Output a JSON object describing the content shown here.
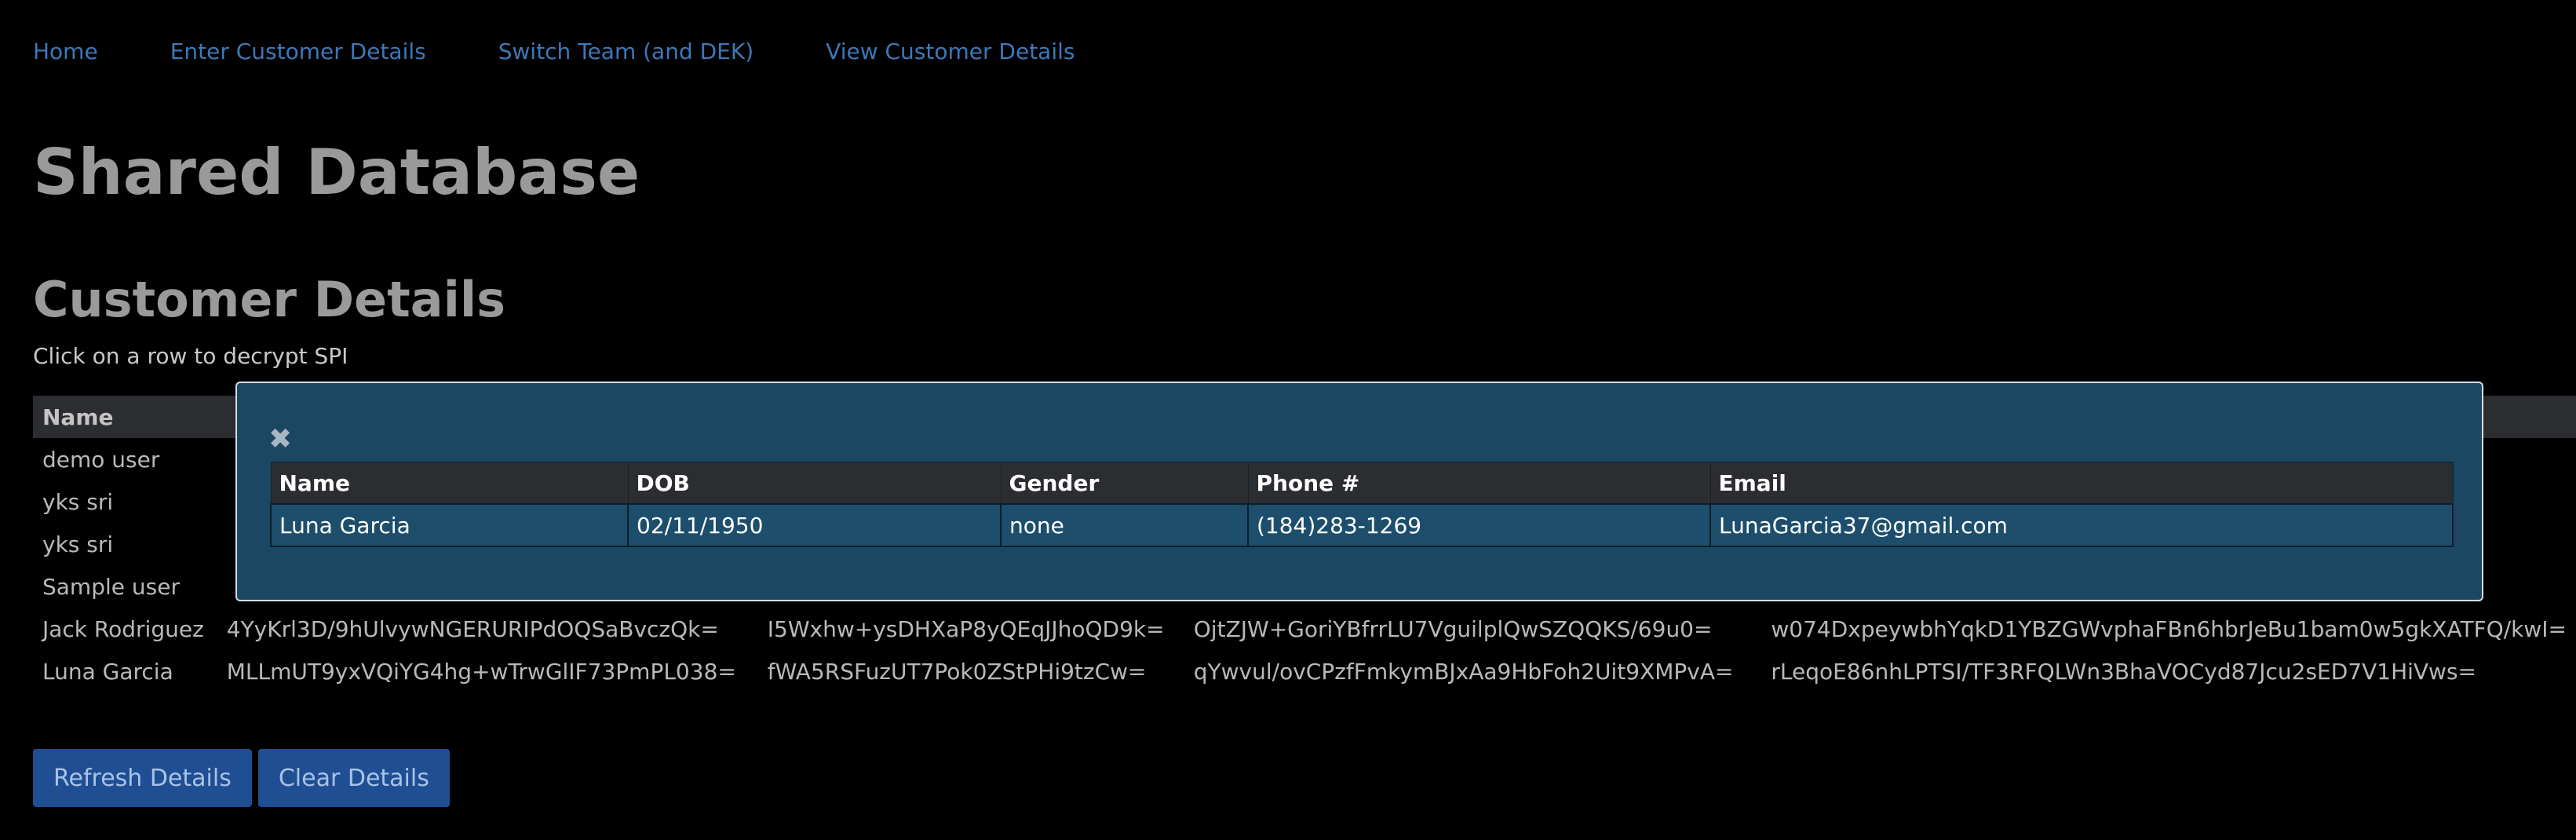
{
  "nav": {
    "items": [
      {
        "label": "Home"
      },
      {
        "label": "Enter Customer Details"
      },
      {
        "label": "Switch Team (and DEK)"
      },
      {
        "label": "View Customer Details"
      }
    ]
  },
  "page": {
    "title": "Shared Database",
    "section_title": "Customer Details",
    "hint": "Click on a row to decrypt SPI"
  },
  "table": {
    "headers": [
      "Name",
      "",
      "",
      "",
      ""
    ],
    "rows": [
      {
        "name": "demo user",
        "c1": "",
        "c2": "",
        "c3": "",
        "c4": ""
      },
      {
        "name": "yks sri",
        "c1": "",
        "c2": "",
        "c3": "",
        "c4": ""
      },
      {
        "name": "yks sri",
        "c1": "",
        "c2": "",
        "c3": "",
        "c4": ""
      },
      {
        "name": "Sample user",
        "c1": "",
        "c2": "",
        "c3": "",
        "c4": ""
      },
      {
        "name": "Jack Rodriguez",
        "c1": "4YyKrl3D/9hUlvywNGERURIPdOQSaBvczQk=",
        "c2": "I5Wxhw+ysDHXaP8yQEqJJhoQD9k=",
        "c3": "OjtZJW+GoriYBfrrLU7VguilplQwSZQQKS/69u0=",
        "c4": "w074DxpeywbhYqkD1YBZGWvphaFBn6hbrJeBu1bam0w5gkXATFQ/kwI="
      },
      {
        "name": "Luna Garcia",
        "c1": "MLLmUT9yxVQiYG4hg+wTrwGlIF73PmPL038=",
        "c2": "fWA5RSFuzUT7Pok0ZStPHi9tzCw=",
        "c3": "qYwvul/ovCPzfFmkymBJxAa9HbFoh2Uit9XMPvA=",
        "c4": "rLeqoE86nhLPTSI/TF3RFQLWn3BhaVOCyd87Jcu2sED7V1HiVws="
      }
    ]
  },
  "buttons": {
    "refresh": "Refresh Details",
    "clear": "Clear Details"
  },
  "modal": {
    "close_glyph": "✖",
    "headers": [
      "Name",
      "DOB",
      "Gender",
      "Phone #",
      "Email"
    ],
    "row": {
      "name": "Luna Garcia",
      "dob": "02/11/1950",
      "gender": "none",
      "phone": "(184)283-1269",
      "email": "LunaGarcia37@gmail.com"
    }
  },
  "colors": {
    "background": "#000000",
    "link": "#3d78b8",
    "button": "#1f4e93",
    "modal_bg": "#1b4762",
    "header_bg": "#2b2d31"
  }
}
